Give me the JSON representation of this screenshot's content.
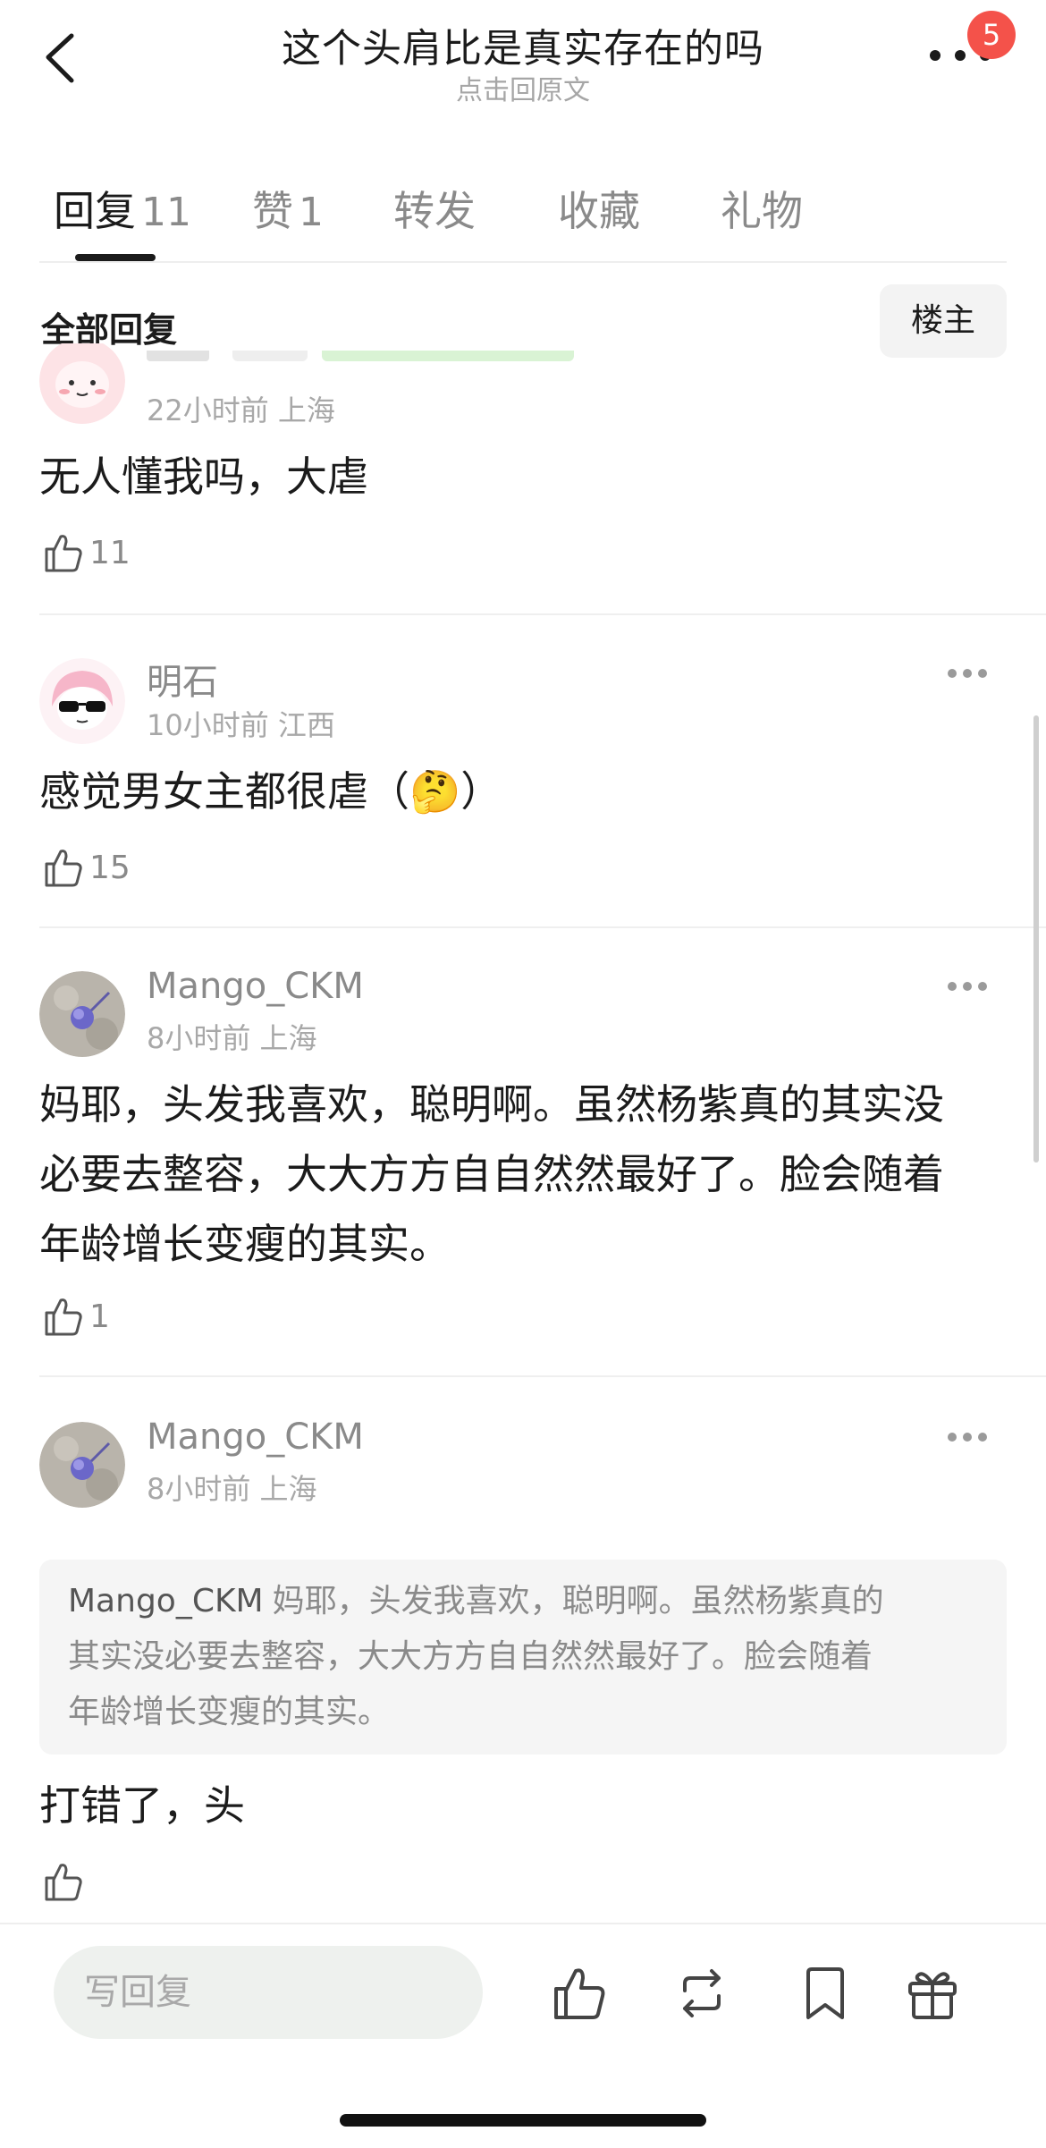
{
  "header": {
    "title": "这个头肩比是真实存在的吗",
    "subtitle": "点击回原文",
    "notification_count": "5"
  },
  "tabs": [
    {
      "label": "回复",
      "count": "11"
    },
    {
      "label": "赞",
      "count": "1"
    },
    {
      "label": "转发",
      "count": ""
    },
    {
      "label": "收藏",
      "count": ""
    },
    {
      "label": "礼物",
      "count": ""
    }
  ],
  "filter": {
    "label": "全部回复",
    "op_button": "楼主"
  },
  "comments": [
    {
      "username": "",
      "time": "22小时前",
      "location": "上海",
      "text": "无人懂我吗，大虐",
      "likes": "11"
    },
    {
      "username": "明石",
      "time": "10小时前",
      "location": "江西",
      "text": "感觉男女主都很虐（🤔）",
      "likes": "15"
    },
    {
      "username": "Mango_CKM",
      "time": "8小时前",
      "location": "上海",
      "text_lines": [
        "妈耶，头发我喜欢，聪明啊。虽然杨紫真的其实没",
        "必要去整容，大大方方自自然然最好了。脸会随着",
        "年龄增长变瘦的其实。"
      ],
      "likes": "1"
    },
    {
      "username": "Mango_CKM",
      "time": "8小时前",
      "location": "上海",
      "quote_author": "Mango_CKM",
      "quote_lines": [
        "妈耶，头发我喜欢，聪明啊。虽然杨紫真的",
        "其实没必要去整容，大大方方自自然然最好了。脸会随着",
        "年龄增长变瘦的其实。"
      ],
      "text": "打错了，头",
      "likes": ""
    }
  ],
  "bottom_bar": {
    "reply_placeholder": "写回复",
    "icons": [
      "like-icon",
      "repost-icon",
      "bookmark-icon",
      "gift-icon"
    ]
  },
  "colors": {
    "badge": "#f4524a",
    "text_primary": "#1b1b1b",
    "text_secondary": "#8a8a8a"
  }
}
